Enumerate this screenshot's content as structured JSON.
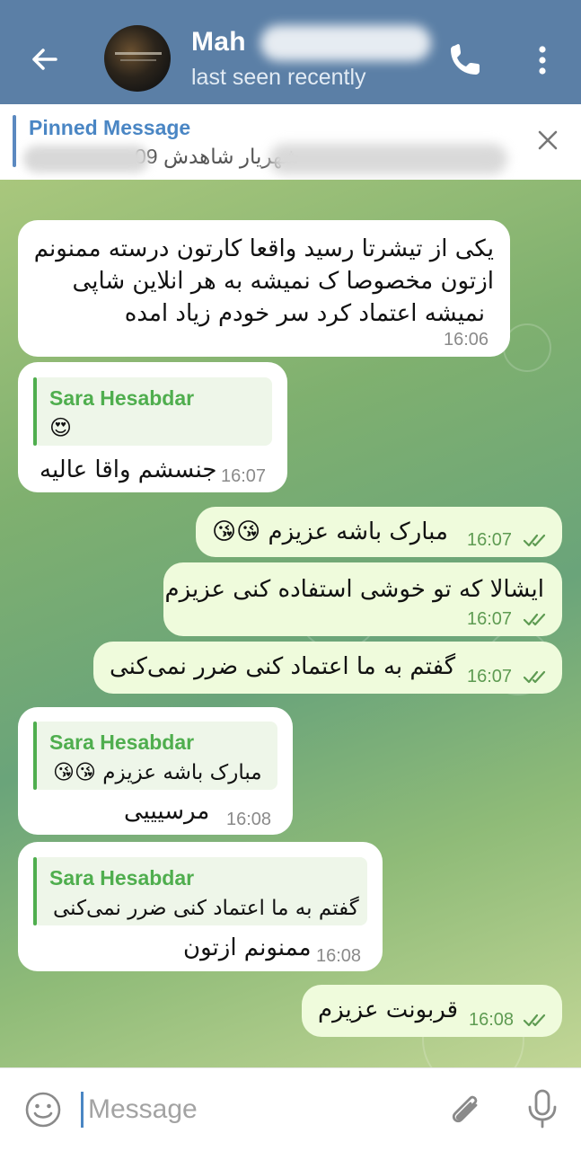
{
  "header": {
    "title": "Mah",
    "subtitle": "last seen recently",
    "icons": [
      "back-arrow-icon",
      "phone-icon",
      "more-vertical-icon"
    ]
  },
  "pinned": {
    "title": "Pinned Message",
    "text": "شهریار شاهدش 09"
  },
  "messages": [
    {
      "dir": "in",
      "text_lines": [
        "یکی از تیشرتا رسید واقعا کارتون درسته ممنونم",
        "ازتون مخصوصا ک نمیشه به هر انلاین شاپی",
        "نمیشه اعتماد کرد سر خودم زیاد امده"
      ],
      "time": "16:06"
    },
    {
      "dir": "in",
      "reply_name": "Sara Hesabdar",
      "reply_text": "😍",
      "text": "جنسشم واقا عالیه",
      "time": "16:07"
    },
    {
      "dir": "out",
      "text": "مبارک باشه عزیزم 😘😘",
      "time": "16:07"
    },
    {
      "dir": "out",
      "text": "ایشالا که تو خوشی استفاده کنی عزیزم",
      "time": "16:07"
    },
    {
      "dir": "out",
      "text": "گفتم به ما اعتماد کنی ضرر نمی‌کنی",
      "time": "16:07"
    },
    {
      "dir": "in",
      "reply_name": "Sara Hesabdar",
      "reply_text": "مبارک باشه عزیزم 😘😘",
      "text": "مرسیییی",
      "time": "16:08"
    },
    {
      "dir": "in",
      "reply_name": "Sara Hesabdar",
      "reply_text": "گفتم به ما اعتماد کنی ضرر نمی‌کنی",
      "text": "ممنونم ازتون",
      "time": "16:08"
    },
    {
      "dir": "out",
      "text": "قربونت عزیزم",
      "time": "16:08"
    }
  ],
  "input": {
    "placeholder": "Message"
  },
  "colors": {
    "header": "#5b7fa6",
    "outgoing_bubble": "#effbdc",
    "reply_accent": "#4fae4e",
    "link": "#4a86c4"
  }
}
